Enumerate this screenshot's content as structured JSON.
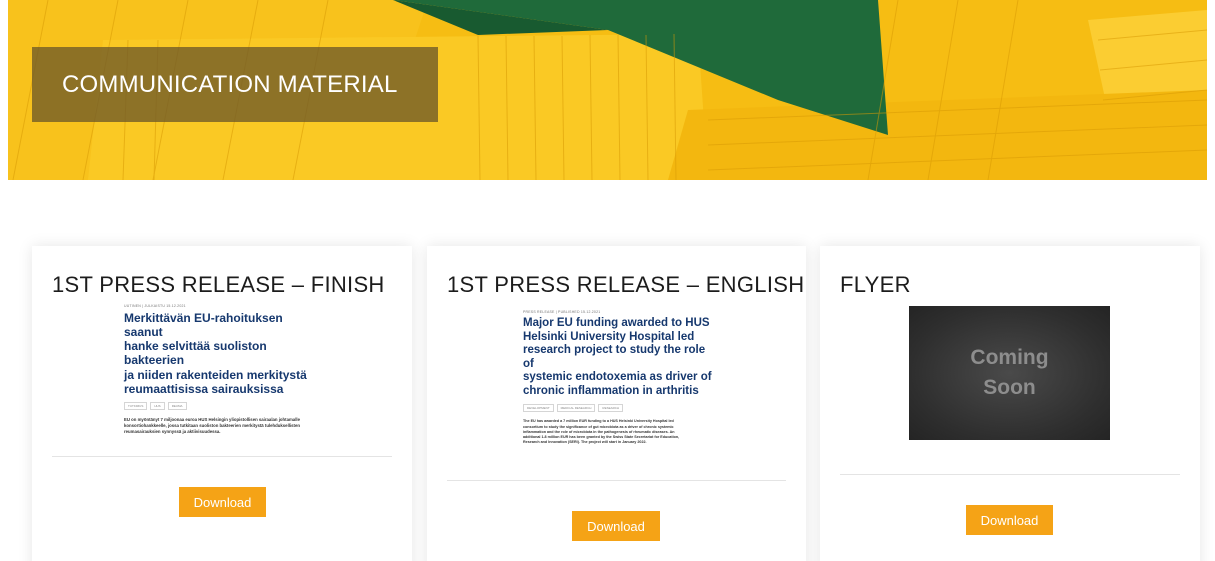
{
  "hero": {
    "title": "COMMUNICATION MATERIAL"
  },
  "cards": [
    {
      "title": "1ST PRESS RELEASE – FINISH",
      "doc": {
        "meta": "UUTINEN | JULKAISTU 15.12.2021",
        "headline_lines": [
          "Merkittävän EU-rahoituksen saanut",
          "hanke selvittää suoliston bakteerien",
          "ja niiden rakenteiden merkitystä",
          "reumaattisissa sairauksissa"
        ],
        "tags": [
          "TUTKIMUS",
          "HUS",
          "REUMA"
        ],
        "body_lines": [
          "EU on myöntänyt 7 miljoonaa euroa HUS Helsingin yliopistollisen sairaalan johtamalle",
          "konsortiohankkeelle, jossa tutkitaan suoliston bakteerien merkitystä tulehduksellisten",
          "reumasairauksien synnyssä ja aktiivisuudessa."
        ]
      },
      "button": "Download"
    },
    {
      "title": "1ST PRESS RELEASE – ENGLISH",
      "doc": {
        "meta": "PRESS RELEASE | PUBLISHED 15.12.2021",
        "headline_lines": [
          "Major EU funding awarded to HUS",
          "Helsinki University Hospital led",
          "research project to study the role of",
          "systemic endotoxemia as driver of",
          "chronic inflammation in arthritis"
        ],
        "tags": [
          "DEVELOPMENT",
          "MEDICAL RESEARCH",
          "RESEARCH"
        ],
        "body_lines": [
          "The EU has awarded a 7 million EUR funding to a HUS Helsinki University Hospital led",
          "consortium to study the significance of gut microbiota as a driver of chronic systemic",
          "inflammation and the role of microbiota in the pathogenesis of rheumatic diseases. An",
          "additional 1.8 million EUR has been granted by the Swiss State Secretariat for Education,",
          "Research and Innovation (SERI). The project will start in January 2022."
        ]
      },
      "button": "Download"
    },
    {
      "title": "FLYER",
      "coming_soon": [
        "Coming",
        "Soon"
      ],
      "button": "Download"
    }
  ],
  "colors": {
    "hero_yellow": "#f6bd13",
    "hero_green": "#1f6a3a",
    "button_orange": "#f5a316",
    "headline_blue": "#16386e"
  }
}
